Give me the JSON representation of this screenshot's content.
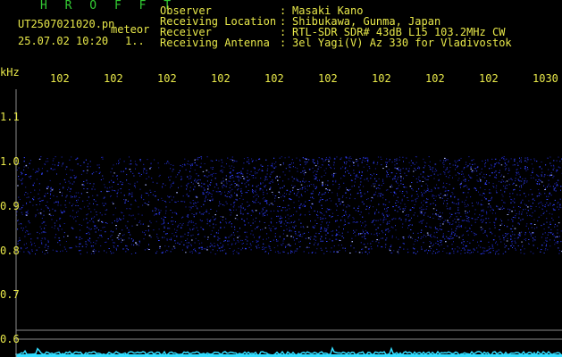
{
  "header": {
    "app_name": "H R O F F T",
    "filename": "UT2507021020.pn",
    "tag": "meteor",
    "timestamp": "25.07.02 10:20",
    "counter": "1..",
    "meta": [
      {
        "label": "Observer",
        "value": "Masaki Kano"
      },
      {
        "label": "Receiving Location",
        "value": "Shibukawa, Gunma, Japan"
      },
      {
        "label": "Receiver",
        "value": "RTL-SDR SDR# 43dB L15 103.2MHz CW"
      },
      {
        "label": "Receiving Antenna",
        "value": "3el Yagi(V) Az 330 for Vladivostok"
      }
    ],
    "colon": ":"
  },
  "axes": {
    "y_unit": "kHz",
    "y_ticks": [
      {
        "label": "1.1",
        "value": 1.1
      },
      {
        "label": "1.0",
        "value": 1.0
      },
      {
        "label": "0.9",
        "value": 0.9
      },
      {
        "label": "0.8",
        "value": 0.8
      },
      {
        "label": "0.7",
        "value": 0.7
      },
      {
        "label": "0.6",
        "value": 0.6
      }
    ],
    "x_ticks": [
      "102",
      "102",
      "102",
      "102",
      "102",
      "102",
      "102",
      "102",
      "102",
      "1030"
    ]
  },
  "colors": {
    "background": "#000000",
    "green_text": "#33cc33",
    "yellow_text": "#e8e84a",
    "signal_blue": "#2a3cff",
    "baseline_cyan": "#33ddff",
    "gridline": "#8a8a8a"
  },
  "signal_band": {
    "low_khz": 0.79,
    "high_khz": 1.01
  }
}
